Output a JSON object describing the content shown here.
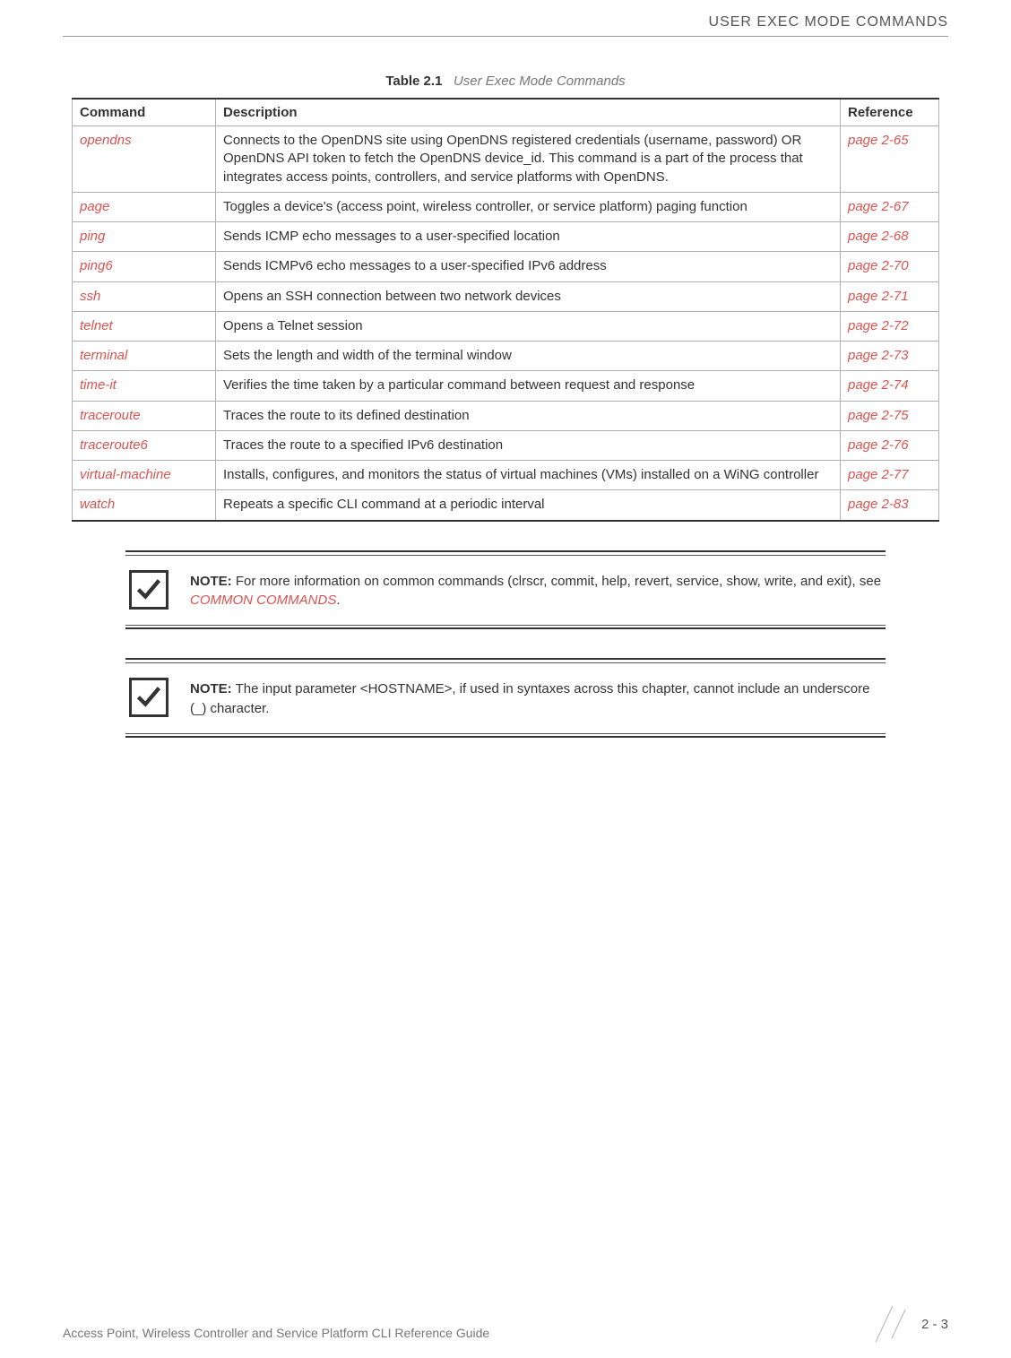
{
  "header": {
    "title": "USER EXEC MODE COMMANDS"
  },
  "table": {
    "caption_bold": "Table 2.1",
    "caption_italic": "User Exec Mode Commands",
    "headers": {
      "command": "Command",
      "description": "Description",
      "reference": "Reference"
    },
    "rows": [
      {
        "command": "opendns",
        "description": "Connects to the OpenDNS site using OpenDNS registered credentials (username, password) OR OpenDNS API token to fetch the OpenDNS device_id. This command is a part of the process that integrates access points, controllers, and service platforms with OpenDNS.",
        "reference": "page 2-65"
      },
      {
        "command": "page",
        "description": "Toggles a device's (access point, wireless controller, or service platform) paging function",
        "reference": "page 2-67"
      },
      {
        "command": "ping",
        "description": "Sends ICMP echo messages to a user-specified location",
        "reference": "page 2-68"
      },
      {
        "command": "ping6",
        "description": "Sends ICMPv6 echo messages to a user-specified IPv6 address",
        "reference": "page 2-70"
      },
      {
        "command": "ssh",
        "description": "Opens an SSH connection between two network devices",
        "reference": "page 2-71"
      },
      {
        "command": "telnet",
        "description": "Opens a Telnet session",
        "reference": "page 2-72"
      },
      {
        "command": "terminal",
        "description": "Sets the length and width of the terminal window",
        "reference": "page 2-73"
      },
      {
        "command": "time-it",
        "description": "Verifies the time taken by a particular command between request and response",
        "reference": "page 2-74"
      },
      {
        "command": "traceroute",
        "description": "Traces the route to its defined destination",
        "reference": "page 2-75"
      },
      {
        "command": "traceroute6",
        "description": "Traces the route to a specified IPv6 destination",
        "reference": "page 2-76"
      },
      {
        "command": "virtual-machine",
        "description": "Installs, configures, and monitors the status of virtual machines (VMs) installed on a WiNG controller",
        "reference": "page 2-77"
      },
      {
        "command": "watch",
        "description": "Repeats a specific CLI command at a periodic interval",
        "reference": "page 2-83"
      }
    ]
  },
  "notes": [
    {
      "label": "NOTE:",
      "text_before": " For more information on common commands (clrscr, commit, help, revert, service, show, write, and exit), see ",
      "link": "COMMON COMMANDS",
      "text_after": "."
    },
    {
      "label": "NOTE:",
      "text_before": " The input parameter <HOSTNAME>, if used in syntaxes across this chapter, cannot include an underscore (_) character.",
      "link": "",
      "text_after": ""
    }
  ],
  "footer": {
    "left": "Access Point, Wireless Controller and Service Platform CLI Reference Guide",
    "page": "2 - 3"
  }
}
